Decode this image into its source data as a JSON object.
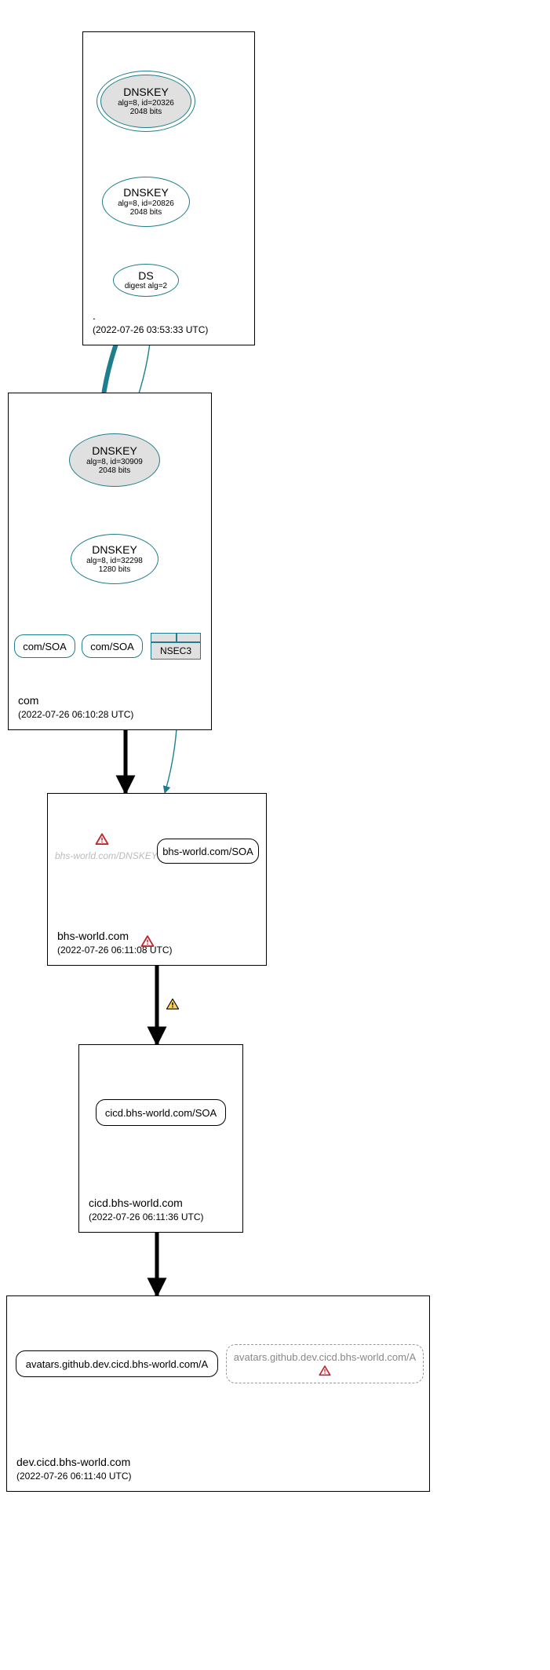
{
  "zones": {
    "root": {
      "name": ".",
      "timestamp": "(2022-07-26 03:53:33 UTC)"
    },
    "com": {
      "name": "com",
      "timestamp": "(2022-07-26 06:10:28 UTC)"
    },
    "bhs": {
      "name": "bhs-world.com",
      "timestamp": "(2022-07-26 06:11:08 UTC)"
    },
    "cicd": {
      "name": "cicd.bhs-world.com",
      "timestamp": "(2022-07-26 06:11:36 UTC)"
    },
    "dev": {
      "name": "dev.cicd.bhs-world.com",
      "timestamp": "(2022-07-26 06:11:40 UTC)"
    }
  },
  "nodes": {
    "root_ksk": {
      "t1": "DNSKEY",
      "t2": "alg=8, id=20326",
      "t3": "2048 bits"
    },
    "root_zsk": {
      "t1": "DNSKEY",
      "t2": "alg=8, id=20826",
      "t3": "2048 bits"
    },
    "root_ds": {
      "t1": "DS",
      "t2": "digest alg=2"
    },
    "com_ksk": {
      "t1": "DNSKEY",
      "t2": "alg=8, id=30909",
      "t3": "2048 bits"
    },
    "com_zsk": {
      "t1": "DNSKEY",
      "t2": "alg=8, id=32298",
      "t3": "1280 bits"
    },
    "com_soa1": {
      "label": "com/SOA"
    },
    "com_soa2": {
      "label": "com/SOA"
    },
    "nsec3": {
      "label": "NSEC3"
    },
    "bhs_dnskey_missing": {
      "label": "bhs-world.com/DNSKEY"
    },
    "bhs_soa": {
      "label": "bhs-world.com/SOA"
    },
    "cicd_soa": {
      "label": "cicd.bhs-world.com/SOA"
    },
    "dev_a_ok": {
      "label": "avatars.github.dev.cicd.bhs-world.com/A"
    },
    "dev_a_bad": {
      "label": "avatars.github.dev.cicd.bhs-world.com/A"
    }
  },
  "chart_data": {
    "type": "dnssec-delegation-graph",
    "zones": [
      {
        "name": ".",
        "timestamp_utc": "2022-07-26 03:53:33",
        "records": [
          {
            "id": "root_ksk",
            "type": "DNSKEY",
            "alg": 8,
            "key_id": 20326,
            "bits": 2048,
            "role": "KSK",
            "secure": true
          },
          {
            "id": "root_zsk",
            "type": "DNSKEY",
            "alg": 8,
            "key_id": 20826,
            "bits": 2048,
            "role": "ZSK",
            "secure": true
          },
          {
            "id": "root_ds",
            "type": "DS",
            "digest_alg": 2,
            "secure": true
          }
        ]
      },
      {
        "name": "com",
        "timestamp_utc": "2022-07-26 06:10:28",
        "records": [
          {
            "id": "com_ksk",
            "type": "DNSKEY",
            "alg": 8,
            "key_id": 30909,
            "bits": 2048,
            "role": "KSK",
            "secure": true
          },
          {
            "id": "com_zsk",
            "type": "DNSKEY",
            "alg": 8,
            "key_id": 32298,
            "bits": 1280,
            "role": "ZSK",
            "secure": true
          },
          {
            "id": "com_soa1",
            "type": "SOA",
            "owner": "com"
          },
          {
            "id": "com_soa2",
            "type": "SOA",
            "owner": "com"
          },
          {
            "id": "nsec3",
            "type": "NSEC3"
          }
        ]
      },
      {
        "name": "bhs-world.com",
        "timestamp_utc": "2022-07-26 06:11:08",
        "status": "error",
        "records": [
          {
            "id": "bhs_dnskey_missing",
            "type": "DNSKEY",
            "owner": "bhs-world.com",
            "status": "error",
            "missing": true
          },
          {
            "id": "bhs_soa",
            "type": "SOA",
            "owner": "bhs-world.com"
          }
        ]
      },
      {
        "name": "cicd.bhs-world.com",
        "timestamp_utc": "2022-07-26 06:11:36",
        "records": [
          {
            "id": "cicd_soa",
            "type": "SOA",
            "owner": "cicd.bhs-world.com"
          }
        ]
      },
      {
        "name": "dev.cicd.bhs-world.com",
        "timestamp_utc": "2022-07-26 06:11:40",
        "records": [
          {
            "id": "dev_a_ok",
            "type": "A",
            "owner": "avatars.github.dev.cicd.bhs-world.com"
          },
          {
            "id": "dev_a_bad",
            "type": "A",
            "owner": "avatars.github.dev.cicd.bhs-world.com",
            "status": "error"
          }
        ]
      }
    ],
    "edges": [
      {
        "from": "root_ksk",
        "to": "root_ksk",
        "secure": true,
        "self": true
      },
      {
        "from": "root_ksk",
        "to": "root_zsk",
        "secure": true
      },
      {
        "from": "root_zsk",
        "to": "root_ds",
        "secure": true
      },
      {
        "from": "root_ds",
        "to": "com_ksk",
        "secure": true,
        "thick": true
      },
      {
        "from": "com_ksk",
        "to": "com_ksk",
        "secure": true,
        "self": true
      },
      {
        "from": "com_ksk",
        "to": "com_zsk",
        "secure": true
      },
      {
        "from": "com_zsk",
        "to": "com_soa1",
        "secure": true
      },
      {
        "from": "com_zsk",
        "to": "com_soa2",
        "secure": true
      },
      {
        "from": "com_zsk",
        "to": "nsec3",
        "secure": true
      },
      {
        "from": "nsec3",
        "to": "bhs-world.com-zone",
        "secure": true
      },
      {
        "from": "com-zone",
        "to": "bhs-world.com-zone",
        "secure": false,
        "thick": true
      },
      {
        "from": "bhs-world.com-zone",
        "to": "cicd.bhs-world.com-zone",
        "secure": false,
        "thick": true,
        "status": "warning"
      },
      {
        "from": "cicd.bhs-world.com-zone",
        "to": "dev.cicd.bhs-world.com-zone",
        "secure": false,
        "thick": true
      }
    ]
  }
}
